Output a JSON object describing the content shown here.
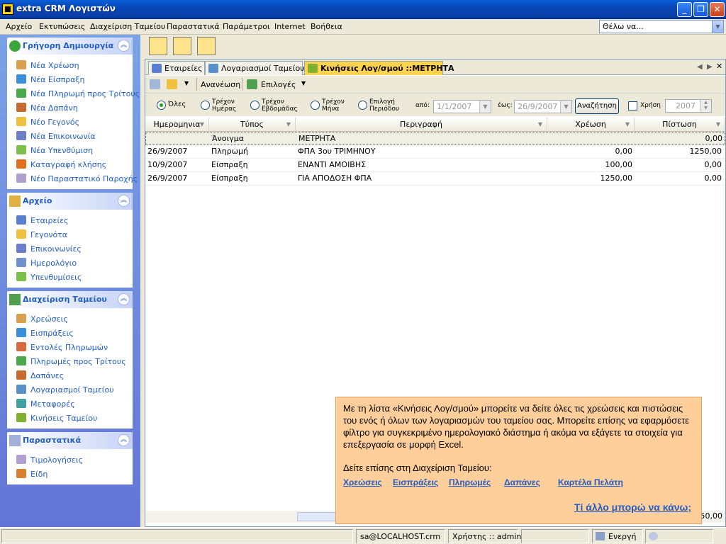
{
  "window": {
    "title": "extra CRM Λογιστών"
  },
  "menu": [
    "Αρχείο",
    "Εκτυπώσεις",
    "Διαχείριση Ταμείου",
    "Παραστατικά",
    "Παράμετροι",
    "Internet",
    "Βοήθεια"
  ],
  "search": {
    "value": "Θέλω να..."
  },
  "sidebar": {
    "quick": {
      "title": "Γρήγορη Δημιουργία",
      "items": [
        "Νέα Χρέωση",
        "Νέα Είσπραξη",
        "Νέα Πληρωμή προς Τρίτους",
        "Νέα Δαπάνη",
        "Νέο Γεγονός",
        "Νέα Επικοινωνία",
        "Νέα Υπενθύμιση",
        "Καταγραφή κλήσης",
        "Νέο Παραστατικό Παροχής"
      ]
    },
    "archive": {
      "title": "Αρχείο",
      "items": [
        "Εταιρείες",
        "Γεγονότα",
        "Επικοινωνίες",
        "Ημερολόγιο",
        "Υπενθυμίσεις"
      ]
    },
    "treasury": {
      "title": "Διαχείριση Ταμείου",
      "items": [
        "Χρεώσεις",
        "Εισπράξεις",
        "Εντολές Πληρωμών",
        "Πληρωμές προς Τρίτους",
        "Δαπάνες",
        "Λογαριασμοί Ταμείου",
        "Μεταφορές",
        "Κινήσεις Ταμείου"
      ]
    },
    "documents": {
      "title": "Παραστατικά",
      "items": [
        "Τιμολογήσεις",
        "Είδη"
      ]
    }
  },
  "tabs": [
    "Εταιρείες",
    "Λογαριασμοί Ταμείου",
    "Κινήσεις Λογ/σμού ::ΜΕΤΡΗΤΑ"
  ],
  "listtools": {
    "refresh": "Ανανέωση",
    "options": "Επιλογές"
  },
  "filter": {
    "all": "Όλες",
    "day": [
      "Τρέχον",
      "Ημέρας"
    ],
    "week": [
      "Τρέχον",
      "Εβδομάδας"
    ],
    "month": [
      "Τρέχον",
      "Μήνα"
    ],
    "period": [
      "Επιλογή",
      "Περιόδου"
    ],
    "from_label": "από:",
    "from_value": "1/1/2007",
    "to_label": "έως:",
    "to_value": "26/9/2007",
    "search_button": "Αναζήτηση",
    "year_label": "Χρήση",
    "year_value": "2007"
  },
  "grid": {
    "headers": [
      "Ημερομηνια",
      "Τύπος",
      "Περιγραφή",
      "Χρέωση",
      "Πίστωση"
    ],
    "rows": [
      [
        "",
        "Άνοιγμα",
        "ΜΕΤΡΗΤΑ",
        "",
        "0,00"
      ],
      [
        "26/9/2007",
        "Πληρωμή",
        "ΦΠΑ 3ου ΤΡΙΜΗΝΟΥ",
        "0,00",
        "1250,00"
      ],
      [
        "10/9/2007",
        "Είσπραξη",
        "ΕΝΑΝΤΙ ΑΜΟΙΒΗΣ",
        "100,00",
        "0,00"
      ],
      [
        "26/9/2007",
        "Είσπραξη",
        "ΓΙΑ ΑΠΟΔΟΣΗ ΦΠΑ",
        "1250,00",
        "0,00"
      ]
    ],
    "footer_total": "50,00"
  },
  "tooltip": {
    "text": "Με τη λίστα «Κινήσεις Λογ/σμού» μπορείτε να δείτε όλες τις χρεώσεις και πιστώσεις του ενός ή όλων των λογαριασμών του ταμείου σας. Μπορείτε επίσης να εφαρμόσετε φίλτρο για συγκεκριμένο ημερολογιακό διάστημα ή ακόμα να εξάγετε τα στοιχεία για επεξεργασία σε μορφή Excel.",
    "see_also": "Δείτε επίσης στη Διαχείριση Ταμείου:",
    "links": [
      "Χρεώσεις",
      "Εισπράξεις",
      "Πληρωμές",
      "Δαπάνες",
      "Καρτέλα Πελάτη"
    ],
    "more": "Τί άλλο μπορώ να κάνω;"
  },
  "status": {
    "server": "sa@LOCALHOST.crm",
    "user": "Χρήστης :: admin",
    "state": "Ενεργή"
  },
  "colors": {
    "title_blue": "#0846b8",
    "link_blue": "#215dc6",
    "tab_active": "#ffd34d",
    "tooltip_bg": "#ffcf9b"
  }
}
